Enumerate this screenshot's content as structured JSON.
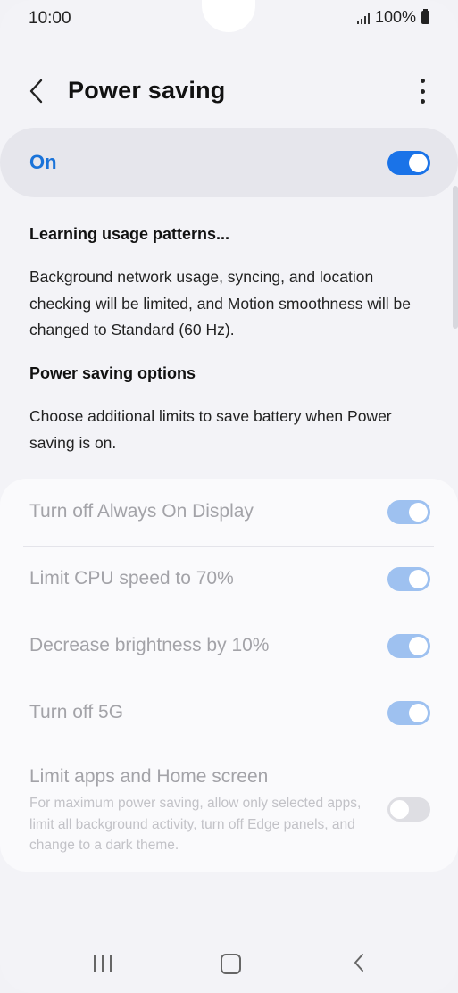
{
  "status_bar": {
    "time": "10:00",
    "battery_text": "100%",
    "signal_icon": "signal-icon",
    "battery_icon": "battery-icon"
  },
  "header": {
    "title": "Power saving",
    "back_icon": "chevron-left-icon",
    "more_icon": "more-vert-icon"
  },
  "main_switch": {
    "label": "On",
    "checked": true,
    "accent_color": "#1a73e8"
  },
  "info": {
    "status_heading": "Learning usage patterns...",
    "description": "Background network usage, syncing, and location checking will be limited, and Motion smoothness will be changed to Standard (60 Hz).",
    "options_heading": "Power saving options",
    "options_description": "Choose additional limits to save battery when Power saving is on."
  },
  "options": [
    {
      "label": "Turn off Always On Display",
      "checked": true,
      "enabled": false
    },
    {
      "label": "Limit CPU speed to 70%",
      "checked": true,
      "enabled": false
    },
    {
      "label": "Decrease brightness by 10%",
      "checked": true,
      "enabled": false
    },
    {
      "label": "Turn off 5G",
      "checked": true,
      "enabled": false
    },
    {
      "label": "Limit apps and Home screen",
      "sublabel": "For maximum power saving, allow only selected apps, limit all background activity, turn off Edge panels, and change to a dark theme.",
      "checked": false,
      "enabled": false
    }
  ],
  "nav_bar": {
    "recents_icon": "recents-icon",
    "home_icon": "home-icon",
    "back_icon": "back-icon"
  }
}
